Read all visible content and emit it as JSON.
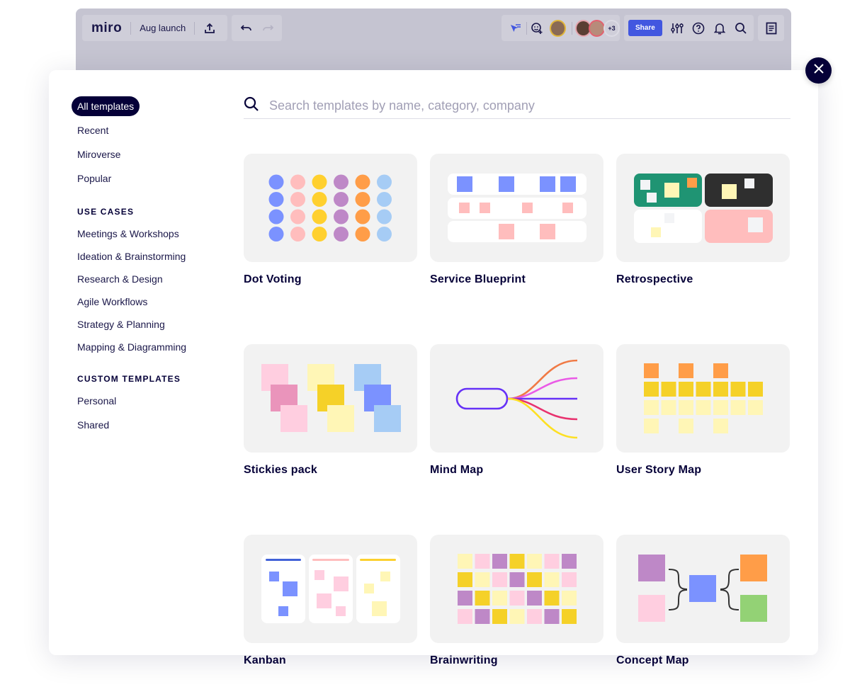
{
  "topbar": {
    "logo": "miro",
    "board_name": "Aug launch",
    "extra_collaborators": "+3",
    "share_label": "Share",
    "icons": [
      "upload-icon",
      "undo-icon",
      "redo-icon",
      "reactions-cursor-icon",
      "add-emoji-icon",
      "settings-sliders-icon",
      "help-icon",
      "bell-icon",
      "search-icon",
      "notes-icon"
    ]
  },
  "modal": {
    "close_label": "×",
    "search": {
      "placeholder": "Search templates by name, category, company",
      "value": ""
    },
    "sidebar": {
      "primary": [
        {
          "label": "All templates",
          "active": true
        },
        {
          "label": "Recent",
          "active": false
        },
        {
          "label": "Miroverse",
          "active": false
        },
        {
          "label": "Popular",
          "active": false
        }
      ],
      "use_cases_heading": "USE CASES",
      "use_cases": [
        "Meetings & Workshops",
        "Ideation & Brainstorming",
        "Research & Design",
        "Agile Workflows",
        "Strategy & Planning",
        "Mapping & Diagramming"
      ],
      "custom_heading": "CUSTOM TEMPLATES",
      "custom": [
        "Personal",
        "Shared"
      ]
    },
    "templates": [
      {
        "title": "Dot Voting"
      },
      {
        "title": "Service Blueprint"
      },
      {
        "title": "Retrospective"
      },
      {
        "title": "Stickies pack"
      },
      {
        "title": "Mind Map"
      },
      {
        "title": "User Story Map"
      },
      {
        "title": "Kanban"
      },
      {
        "title": "Brainwriting"
      },
      {
        "title": "Concept Map"
      }
    ]
  },
  "colors": {
    "primary_dark": "#050038",
    "share_blue": "#4257e0",
    "blue": "#7b92ff",
    "pink": "#ffbdbd",
    "yellow": "#ffd02f",
    "purple": "#be88c7",
    "orange": "#ff9d48",
    "light_blue": "#a6ccf5",
    "light_yellow": "#fff6b6",
    "sticky_yellow": "#f5d128",
    "light_pink": "#ffcee0",
    "green_board": "#1f9473",
    "dark_board": "#2f2f2f",
    "green": "#93d275"
  }
}
